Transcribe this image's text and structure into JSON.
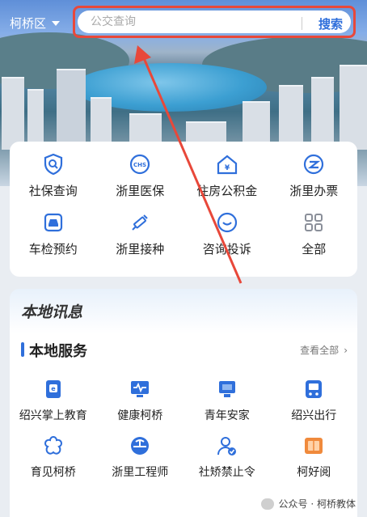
{
  "header": {
    "region": "柯桥区",
    "search_placeholder": "公交查询",
    "search_button": "搜索"
  },
  "quick_grid": [
    {
      "label": "社保查询",
      "icon": "shield-search-icon"
    },
    {
      "label": "浙里医保",
      "icon": "medical-insurance-icon"
    },
    {
      "label": "住房公积金",
      "icon": "house-yuan-icon"
    },
    {
      "label": "浙里办票",
      "icon": "ticket-icon"
    },
    {
      "label": "车检预约",
      "icon": "car-icon"
    },
    {
      "label": "浙里接种",
      "icon": "syringe-icon"
    },
    {
      "label": "咨询投诉",
      "icon": "chat-icon"
    },
    {
      "label": "全部",
      "icon": "grid-icon"
    }
  ],
  "news": {
    "title": "本地讯息"
  },
  "local_services": {
    "title": "本地服务",
    "view_all": "查看全部",
    "items": [
      {
        "label": "绍兴掌上教育",
        "icon": "education-icon"
      },
      {
        "label": "健康柯桥",
        "icon": "health-monitor-icon"
      },
      {
        "label": "青年安家",
        "icon": "youth-home-icon"
      },
      {
        "label": "绍兴出行",
        "icon": "bus-icon"
      },
      {
        "label": "育见柯桥",
        "icon": "flower-icon"
      },
      {
        "label": "浙里工程师",
        "icon": "helmet-icon"
      },
      {
        "label": "社矫禁止令",
        "icon": "person-check-icon"
      },
      {
        "label": "柯好阅",
        "icon": "book-icon"
      }
    ]
  },
  "watermark": "公众号 · 柯桥教体",
  "colors": {
    "accent": "#2f6fdb",
    "highlight": "#e8483a"
  }
}
